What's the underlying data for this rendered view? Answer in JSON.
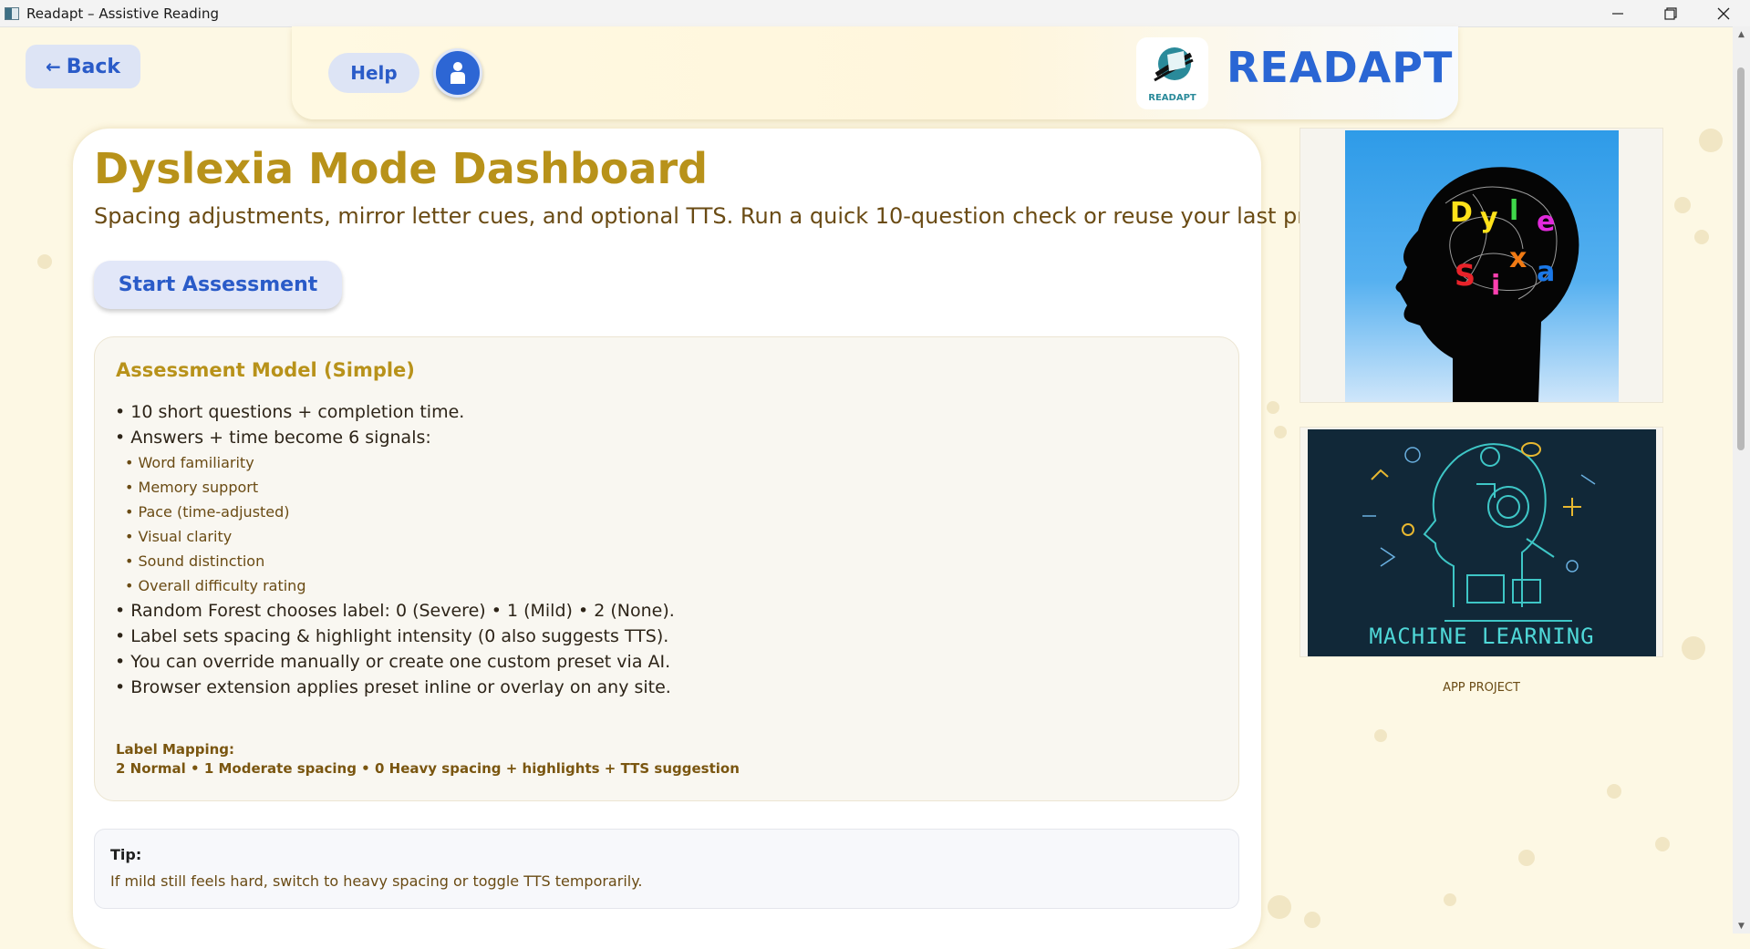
{
  "window": {
    "title": "Readapt – Assistive Reading",
    "controls": [
      "minimize-icon",
      "restore-icon",
      "close-icon"
    ]
  },
  "nav": {
    "back_label": "Back",
    "help_label": "Help",
    "profile_icon": "person-icon"
  },
  "brand": {
    "name": "READAPT",
    "logo_text": "READAPT"
  },
  "main": {
    "title": "Dyslexia Mode Dashboard",
    "subtitle": "Spacing adjustments, mirror letter cues, and optional TTS. Run a quick 10-question check or reuse your last preset.",
    "start_button": "Start Assessment",
    "model": {
      "title": "Assessment Model (Simple)",
      "bullets_before": [
        "• 10 short questions + completion time.",
        "• Answers + time become 6 signals:"
      ],
      "signals": [
        "• Word familiarity",
        "• Memory support",
        "• Pace (time-adjusted)",
        "• Visual clarity",
        "• Sound distinction",
        "• Overall difficulty rating"
      ],
      "bullets_after": [
        "• Random Forest chooses label: 0 (Severe) • 1 (Mild) • 2 (None).",
        "• Label sets spacing & highlight intensity (0 also suggests TTS).",
        "• You can override manually or create one custom preset via AI.",
        "• Browser extension applies preset inline or overlay on any site."
      ],
      "mapping_label": "Label Mapping:",
      "mapping_text": "2 Normal • 1 Moderate spacing • 0 Heavy spacing + highlights + TTS suggestion"
    },
    "tip": {
      "label": "Tip:",
      "text": "If mild still feels hard, switch to heavy spacing or toggle TTS temporarily."
    }
  },
  "sidebar": {
    "image1_letters": [
      "D",
      "y",
      "l",
      "e",
      "x",
      "S",
      "i",
      "a"
    ],
    "image2_caption": "MACHINE LEARNING",
    "caption": "APP PROJECT"
  },
  "colors": {
    "accent_gold": "#b8921a",
    "accent_blue": "#2a5bc8",
    "text_brown": "#6a4b14",
    "background": "#fdf8e4"
  }
}
